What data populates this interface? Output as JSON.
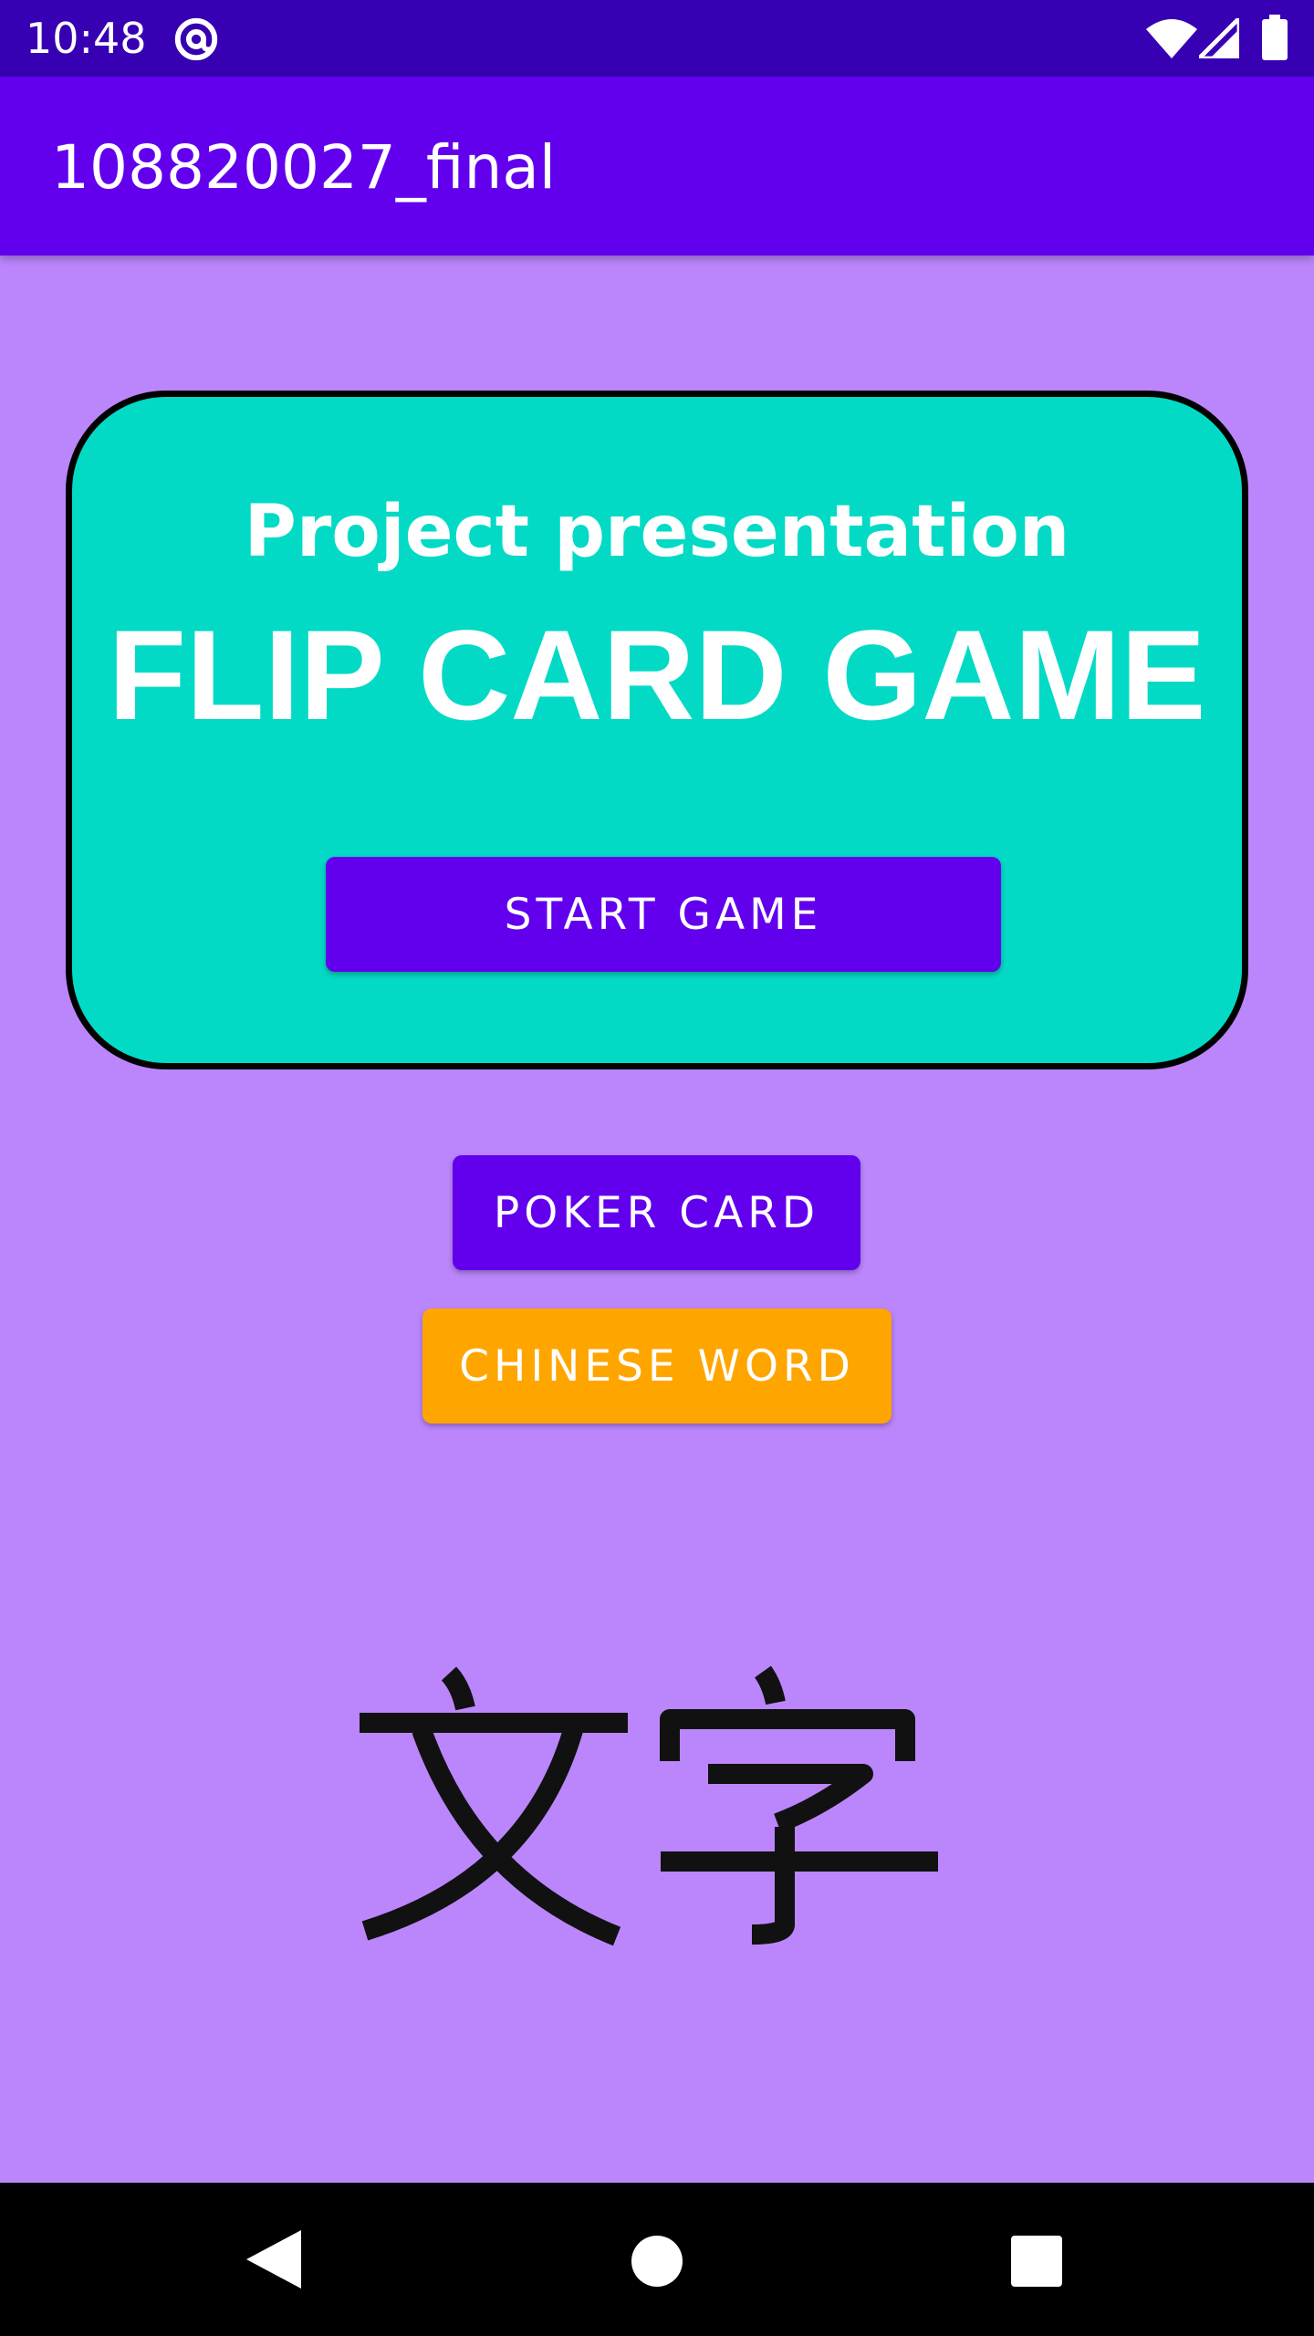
{
  "status_bar": {
    "time": "10:48",
    "icons": [
      "at-sign-icon",
      "wifi-icon",
      "cell-signal-icon",
      "battery-icon"
    ]
  },
  "app_bar": {
    "title": "108820027_final"
  },
  "card": {
    "subtitle": "Project presentation",
    "title": "FLIP CARD GAME",
    "start_button_label": "START GAME"
  },
  "buttons": {
    "poker_label": "POKER CARD",
    "chinese_label": "CHINESE WORD"
  },
  "image": {
    "text": "文字"
  },
  "nav_bar": {
    "icons": [
      "back-icon",
      "home-icon",
      "recents-icon"
    ]
  },
  "colors": {
    "background": "#bb86fc",
    "status_bar": "#3700b3",
    "app_bar": "#6200ee",
    "card": "#03dac5",
    "primary_button": "#6200ee",
    "chinese_button": "#ffa500"
  }
}
